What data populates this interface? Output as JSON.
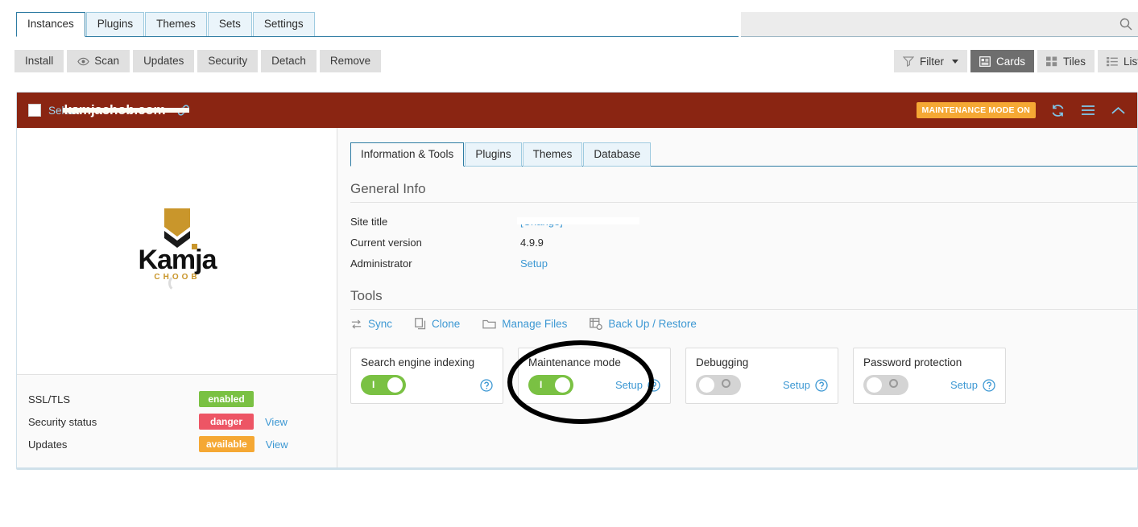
{
  "nav_tabs": [
    {
      "label": "Instances",
      "active": true
    },
    {
      "label": "Plugins",
      "active": false
    },
    {
      "label": "Themes",
      "active": false
    },
    {
      "label": "Sets",
      "active": false
    },
    {
      "label": "Settings",
      "active": false
    }
  ],
  "search": {
    "value": "",
    "placeholder": "",
    "icon": "search-icon"
  },
  "toolbar": {
    "buttons": [
      {
        "label": "Install",
        "icon": null
      },
      {
        "label": "Scan",
        "icon": "eye-icon"
      },
      {
        "label": "Updates",
        "icon": null
      },
      {
        "label": "Security",
        "icon": null
      },
      {
        "label": "Detach",
        "icon": null
      },
      {
        "label": "Remove",
        "icon": null
      }
    ],
    "filter_label": "Filter",
    "views": [
      {
        "label": "Cards",
        "icon": "cards-icon",
        "selected": true
      },
      {
        "label": "Tiles",
        "icon": "tiles-icon",
        "selected": false
      },
      {
        "label": "List",
        "icon": "list-icon",
        "selected": false
      }
    ]
  },
  "instance": {
    "select_label": "Select",
    "domain": "kamjachob.com",
    "domain_redacted": true,
    "link_icon": "link-icon",
    "maintenance_badge": "MAINTENANCE MODE ON",
    "header_icons": [
      "refresh-icon",
      "menu-icon",
      "chevron-up-icon"
    ],
    "header_color": "#8a2512",
    "badge_color": "#f5a834"
  },
  "logo": {
    "wordmark": "Kamja",
    "subtext": "CHOOB",
    "gold": "#c9962b"
  },
  "status_rows": [
    {
      "label": "SSL/TLS",
      "badge": "enabled",
      "badge_color": "#7ac143",
      "link": null
    },
    {
      "label": "Security status",
      "badge": "danger",
      "badge_color": "#ed5565",
      "link": "View"
    },
    {
      "label": "Updates",
      "badge": "available",
      "badge_color": "#f5a834",
      "link": "View"
    }
  ],
  "sub_tabs": [
    {
      "label": "Information & Tools",
      "active": true
    },
    {
      "label": "Plugins",
      "active": false
    },
    {
      "label": "Themes",
      "active": false
    },
    {
      "label": "Database",
      "active": false
    }
  ],
  "general_info": {
    "title": "General Info",
    "rows": [
      {
        "label": "Site title",
        "value": "",
        "link": "[Change]",
        "redacted": true
      },
      {
        "label": "Current version",
        "value": "4.9.9",
        "link": null,
        "redacted": false
      },
      {
        "label": "Administrator",
        "value": "",
        "link": "Setup",
        "redacted": false
      }
    ]
  },
  "tools": {
    "title": "Tools",
    "links": [
      {
        "label": "Sync",
        "icon": "sync-icon"
      },
      {
        "label": "Clone",
        "icon": "clone-icon"
      },
      {
        "label": "Manage Files",
        "icon": "folder-icon"
      },
      {
        "label": "Back Up / Restore",
        "icon": "backup-icon"
      }
    ]
  },
  "tiles": [
    {
      "title": "Search engine indexing",
      "state": "on",
      "setup": null,
      "help": "help-icon"
    },
    {
      "title": "Maintenance mode",
      "state": "on",
      "setup": "Setup",
      "help": "help-icon",
      "annotated": true
    },
    {
      "title": "Debugging",
      "state": "off",
      "setup": "Setup",
      "help": "help-icon"
    },
    {
      "title": "Password protection",
      "state": "off",
      "setup": "Setup",
      "help": "help-icon"
    }
  ]
}
